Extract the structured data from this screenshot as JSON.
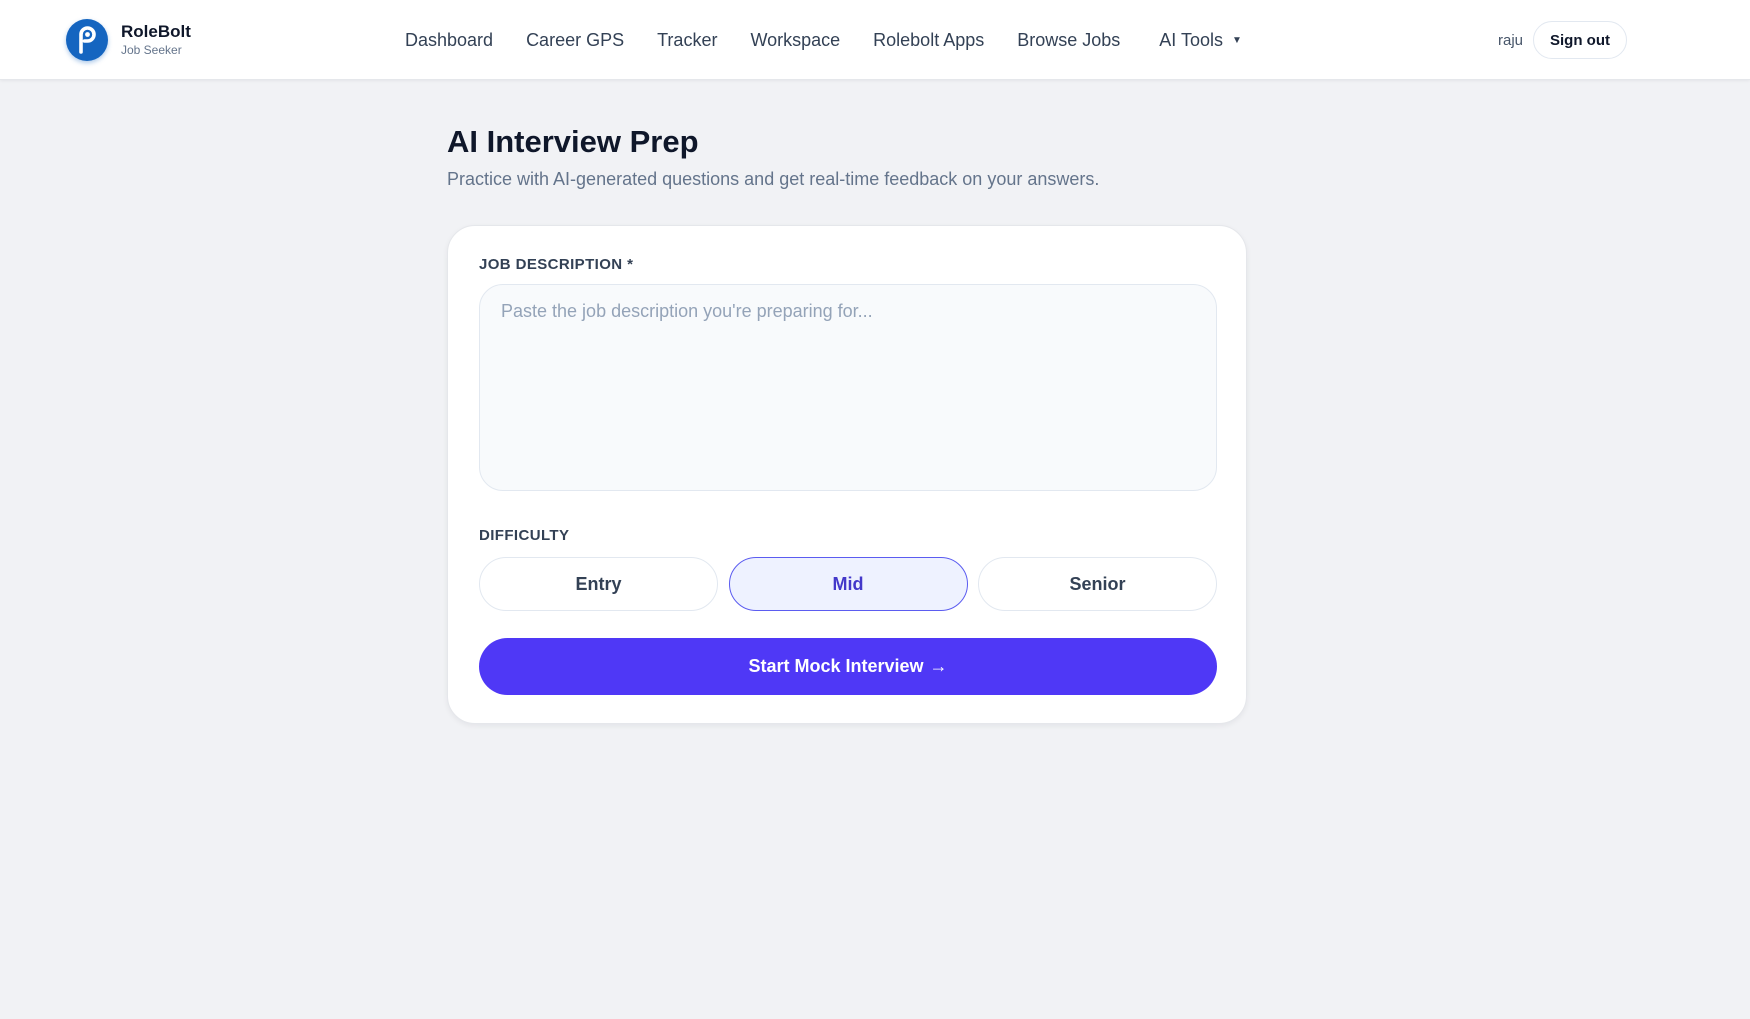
{
  "brand": {
    "name": "RoleBolt",
    "subtitle": "Job Seeker"
  },
  "nav": {
    "items": [
      {
        "label": "Dashboard"
      },
      {
        "label": "Career GPS"
      },
      {
        "label": "Tracker"
      },
      {
        "label": "Workspace"
      },
      {
        "label": "Rolebolt Apps"
      },
      {
        "label": "Browse Jobs"
      },
      {
        "label": "AI Tools",
        "has_dropdown": true
      }
    ],
    "caret_icon": "caret-down-icon"
  },
  "user": {
    "name": "raju",
    "signout_label": "Sign out"
  },
  "page": {
    "title": "AI Interview Prep",
    "subtitle": "Practice with AI-generated questions and get real-time feedback on your answers."
  },
  "form": {
    "job_description": {
      "label": "JOB DESCRIPTION *",
      "placeholder": "Paste the job description you're preparing for...",
      "value": ""
    },
    "difficulty": {
      "label": "DIFFICULTY",
      "options": [
        "Entry",
        "Mid",
        "Senior"
      ],
      "selected": "Mid"
    },
    "start_button": {
      "label": "Start Mock Interview",
      "arrow": "→"
    }
  },
  "colors": {
    "brand_blue": "#1565c0",
    "accent": "#4f38f6",
    "selected_bg": "#eef2ff",
    "selected_border": "#5b5cf0",
    "page_bg": "#f1f2f5"
  }
}
